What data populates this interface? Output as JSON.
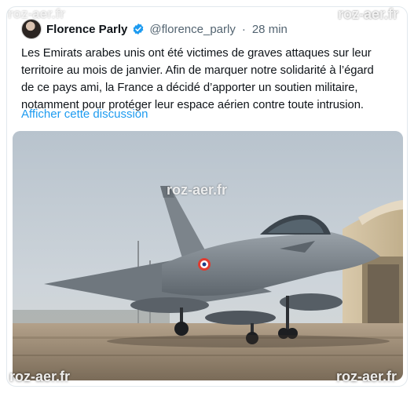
{
  "tweet": {
    "author_name": "Florence Parly",
    "handle": "@florence_parly",
    "separator": "·",
    "time": "28 min",
    "text": "Les Emirats arabes unis ont été victimes de graves attaques sur leur\nterritoire au mois de janvier. Afin de marquer notre solidarité à l’égard\nde ce pays ami, la France a décidé d’apporter un soutien militaire,\nnotamment pour protéger leur espace aérien contre toute intrusion.",
    "show_thread_label": "Afficher cette discussion"
  },
  "media": {
    "description_icon": "rafale-jet-photo",
    "watermarks": [
      "roz-aer.fr",
      "roz-aer.fr",
      "roz-aer.fr",
      "roz-aer.fr",
      "roz-aer.fr"
    ]
  },
  "colors": {
    "link": "#1d9bf0",
    "verified_badge": "#1d9bf0",
    "text_primary": "#0f1419",
    "text_secondary": "#536471"
  }
}
